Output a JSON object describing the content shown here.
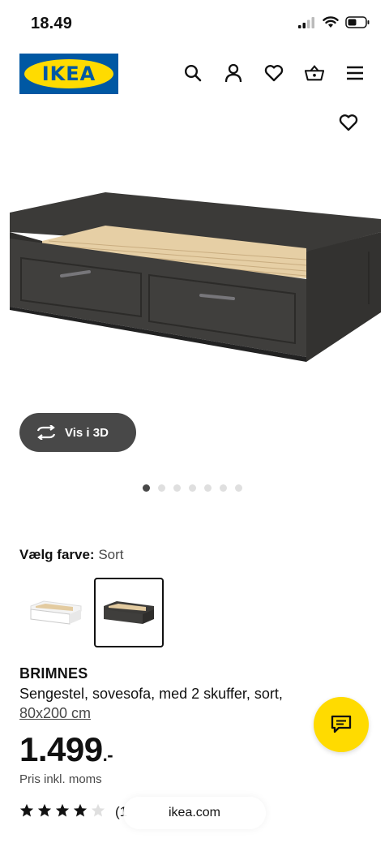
{
  "status_bar": {
    "time": "18.49"
  },
  "header": {
    "logo_text": "IKEA"
  },
  "colors": {
    "ikea_blue": "#0058a3",
    "ikea_yellow": "#ffdb00",
    "dark_button": "#484848"
  },
  "icons": [
    "search-icon",
    "user-icon",
    "heart-icon",
    "basket-icon",
    "menu-icon",
    "rotate-3d-icon",
    "chat-icon",
    "star-icon"
  ],
  "product": {
    "view_3d_label": "Vis i 3D",
    "carousel": {
      "total_images": 7,
      "active_index": 0
    },
    "color_label": "Vælg farve:",
    "color_value": "Sort",
    "swatches": [
      {
        "name": "hvid",
        "selected": false
      },
      {
        "name": "sort",
        "selected": true
      }
    ],
    "name": "BRIMNES",
    "description": "Sengestel, sovesofa, med 2 skuffer, sort,",
    "size": "80x200 cm",
    "price": "1.499",
    "price_suffix": ".-",
    "price_note": "Pris inkl. moms",
    "rating": {
      "stars": 4,
      "max": 5,
      "count_text": "(1"
    }
  },
  "browser": {
    "url": "ikea.com"
  }
}
